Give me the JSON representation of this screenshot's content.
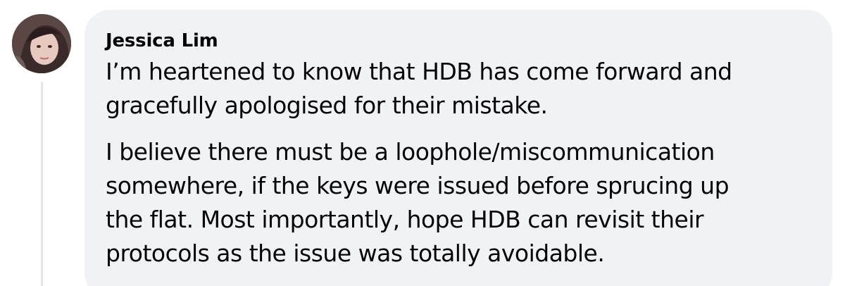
{
  "comment": {
    "author": "Jessica Lim",
    "paragraphs": [
      "I’m heartened to know that HDB has come forward and\ngracefully apologised for their mistake.",
      "I believe there must be a loophole/miscommunication\nsomewhere, if the keys were issued before sprucing up\nthe flat. Most importantly, hope HDB can revisit their\nprotocols as the issue was totally avoidable."
    ]
  },
  "colors": {
    "bubble_background": "#f0f2f5",
    "text": "#050505",
    "thread_line": "#e4e6eb"
  },
  "icons": {
    "avatar": "profile-photo"
  }
}
